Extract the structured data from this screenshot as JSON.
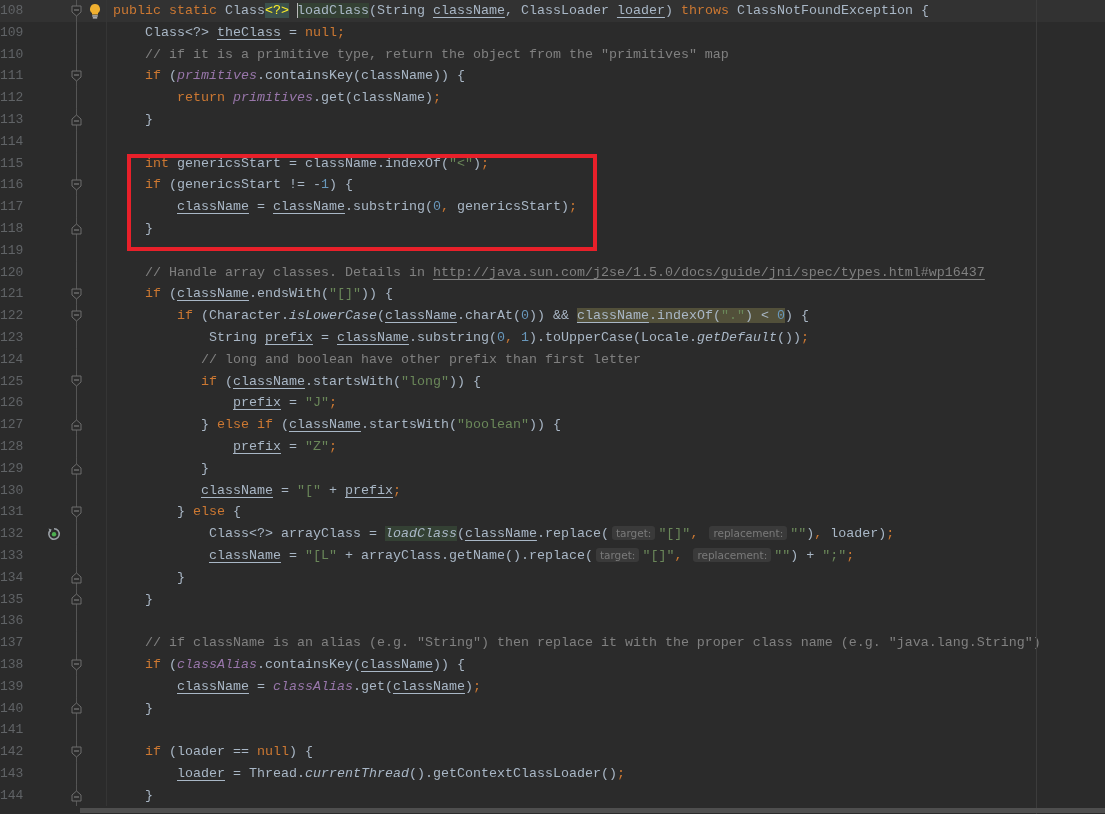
{
  "lines": [
    {
      "number": "108",
      "current": true,
      "fold_start": true,
      "lightbulb": true,
      "tokens": [
        {
          "text": "public static ",
          "kind": "kw"
        },
        {
          "text": "Class",
          "kind": "p"
        },
        {
          "text": "<?>",
          "kind": "p",
          "brace_match": true
        },
        {
          "text": " loadClass",
          "kind": "p",
          "usage": true,
          "caret": true
        },
        {
          "text": "(String ",
          "kind": "p"
        },
        {
          "text": "className",
          "kind": "var"
        },
        {
          "text": ", ClassLoader ",
          "kind": "p"
        },
        {
          "text": "loader",
          "kind": "var"
        },
        {
          "text": ") ",
          "kind": "p"
        },
        {
          "text": "throws ",
          "kind": "kw"
        },
        {
          "text": "ClassNotFoundException {",
          "kind": "p"
        }
      ]
    },
    {
      "number": "109",
      "tokens": [
        {
          "text": "    Class<?> ",
          "kind": "p"
        },
        {
          "text": "theClass",
          "kind": "var"
        },
        {
          "text": " = ",
          "kind": "p"
        },
        {
          "text": "null;",
          "kind": "kw"
        }
      ]
    },
    {
      "number": "110",
      "tokens": [
        {
          "text": "    // if it is a primitive type, return the object from the \"primitives\" map",
          "kind": "comment"
        }
      ]
    },
    {
      "number": "111",
      "fold_start": true,
      "tokens": [
        {
          "text": "    if ",
          "kind": "kw"
        },
        {
          "text": "(",
          "kind": "p"
        },
        {
          "text": "primitives",
          "kind": "field"
        },
        {
          "text": ".containsKey(className)) {",
          "kind": "p"
        }
      ]
    },
    {
      "number": "112",
      "tokens": [
        {
          "text": "        return ",
          "kind": "kw"
        },
        {
          "text": "primitives",
          "kind": "field"
        },
        {
          "text": ".get(className)",
          "kind": "p"
        },
        {
          "text": ";",
          "kind": "kw"
        }
      ]
    },
    {
      "number": "113",
      "fold_end": true,
      "tokens": [
        {
          "text": "    }",
          "kind": "p"
        }
      ]
    },
    {
      "number": "114"
    },
    {
      "number": "115",
      "boxed": true,
      "tokens": [
        {
          "text": "    int ",
          "kind": "kw"
        },
        {
          "text": "genericsStart = className.indexOf(",
          "kind": "p"
        },
        {
          "text": "\"<\"",
          "kind": "str"
        },
        {
          "text": ")",
          "kind": "p"
        },
        {
          "text": ";",
          "kind": "kw"
        }
      ]
    },
    {
      "number": "116",
      "boxed": true,
      "fold_start": true,
      "tokens": [
        {
          "text": "    if ",
          "kind": "kw"
        },
        {
          "text": "(genericsStart != -",
          "kind": "p"
        },
        {
          "text": "1",
          "kind": "num"
        },
        {
          "text": ") {",
          "kind": "p"
        }
      ]
    },
    {
      "number": "117",
      "boxed": true,
      "tokens": [
        {
          "text": "        className",
          "kind": "var"
        },
        {
          "text": " = ",
          "kind": "p"
        },
        {
          "text": "className",
          "kind": "var"
        },
        {
          "text": ".substring(",
          "kind": "p"
        },
        {
          "text": "0",
          "kind": "num"
        },
        {
          "text": ", ",
          "kind": "kw"
        },
        {
          "text": "genericsStart)",
          "kind": "p"
        },
        {
          "text": ";",
          "kind": "kw"
        }
      ]
    },
    {
      "number": "118",
      "boxed": true,
      "fold_end": true,
      "tokens": [
        {
          "text": "    }",
          "kind": "p"
        }
      ]
    },
    {
      "number": "119"
    },
    {
      "number": "120",
      "tokens": [
        {
          "text": "    // Handle array classes. Details in ",
          "kind": "comment"
        },
        {
          "text": "http://java.sun.com/j2se/1.5.0/docs/guide/jni/spec/types.html#wp16437",
          "kind": "link"
        }
      ]
    },
    {
      "number": "121",
      "fold_start": true,
      "tokens": [
        {
          "text": "    if ",
          "kind": "kw"
        },
        {
          "text": "(",
          "kind": "p"
        },
        {
          "text": "className",
          "kind": "var"
        },
        {
          "text": ".endsWith(",
          "kind": "p"
        },
        {
          "text": "\"[]\"",
          "kind": "str"
        },
        {
          "text": ")) {",
          "kind": "p"
        }
      ]
    },
    {
      "number": "122",
      "fold_start": true,
      "tokens": [
        {
          "text": "        if ",
          "kind": "kw"
        },
        {
          "text": "(Character.",
          "kind": "p"
        },
        {
          "text": "isLowerCase",
          "kind": "italic"
        },
        {
          "text": "(",
          "kind": "p"
        },
        {
          "text": "className",
          "kind": "var"
        },
        {
          "text": ".charAt(",
          "kind": "p"
        },
        {
          "text": "0",
          "kind": "num"
        },
        {
          "text": ")) && ",
          "kind": "p"
        },
        {
          "text": "className",
          "kind": "var",
          "warning": true
        },
        {
          "text": ".indexOf(",
          "kind": "p",
          "warning": true
        },
        {
          "text": "\".\"",
          "kind": "str",
          "warning": true
        },
        {
          "text": ") < ",
          "kind": "p",
          "warning": true
        },
        {
          "text": "0",
          "kind": "num",
          "warning": true
        },
        {
          "text": ") {",
          "kind": "p"
        }
      ]
    },
    {
      "number": "123",
      "tokens": [
        {
          "text": "            String ",
          "kind": "p"
        },
        {
          "text": "prefix",
          "kind": "var"
        },
        {
          "text": " = ",
          "kind": "p"
        },
        {
          "text": "className",
          "kind": "var"
        },
        {
          "text": ".substring(",
          "kind": "p"
        },
        {
          "text": "0",
          "kind": "num"
        },
        {
          "text": ", ",
          "kind": "kw"
        },
        {
          "text": "1",
          "kind": "num"
        },
        {
          "text": ").toUpperCase(Locale.",
          "kind": "p"
        },
        {
          "text": "getDefault",
          "kind": "italic"
        },
        {
          "text": "())",
          "kind": "p"
        },
        {
          "text": ";",
          "kind": "kw"
        }
      ]
    },
    {
      "number": "124",
      "tokens": [
        {
          "text": "           // long and boolean have other prefix than first letter",
          "kind": "comment"
        }
      ]
    },
    {
      "number": "125",
      "fold_start": true,
      "tokens": [
        {
          "text": "           if ",
          "kind": "kw"
        },
        {
          "text": "(",
          "kind": "p"
        },
        {
          "text": "className",
          "kind": "var"
        },
        {
          "text": ".startsWith(",
          "kind": "p"
        },
        {
          "text": "\"long\"",
          "kind": "str"
        },
        {
          "text": ")) {",
          "kind": "p"
        }
      ]
    },
    {
      "number": "126",
      "tokens": [
        {
          "text": "               prefix",
          "kind": "var"
        },
        {
          "text": " = ",
          "kind": "p"
        },
        {
          "text": "\"J\"",
          "kind": "str"
        },
        {
          "text": ";",
          "kind": "kw"
        }
      ]
    },
    {
      "number": "127",
      "fold_end": true,
      "tokens": [
        {
          "text": "           } ",
          "kind": "p"
        },
        {
          "text": "else if ",
          "kind": "kw"
        },
        {
          "text": "(",
          "kind": "p"
        },
        {
          "text": "className",
          "kind": "var"
        },
        {
          "text": ".startsWith(",
          "kind": "p"
        },
        {
          "text": "\"boolean\"",
          "kind": "str"
        },
        {
          "text": ")) {",
          "kind": "p"
        }
      ]
    },
    {
      "number": "128",
      "tokens": [
        {
          "text": "               prefix",
          "kind": "var"
        },
        {
          "text": " = ",
          "kind": "p"
        },
        {
          "text": "\"Z\"",
          "kind": "str"
        },
        {
          "text": ";",
          "kind": "kw"
        }
      ]
    },
    {
      "number": "129",
      "fold_end": true,
      "tokens": [
        {
          "text": "           }",
          "kind": "p"
        }
      ]
    },
    {
      "number": "130",
      "tokens": [
        {
          "text": "           className",
          "kind": "var"
        },
        {
          "text": " = ",
          "kind": "p"
        },
        {
          "text": "\"[\"",
          "kind": "str"
        },
        {
          "text": " + ",
          "kind": "p"
        },
        {
          "text": "prefix",
          "kind": "var"
        },
        {
          "text": ";",
          "kind": "kw"
        }
      ]
    },
    {
      "number": "131",
      "fold_start": true,
      "tokens": [
        {
          "text": "        } ",
          "kind": "p"
        },
        {
          "text": "else ",
          "kind": "kw"
        },
        {
          "text": "{",
          "kind": "p"
        }
      ]
    },
    {
      "number": "132",
      "recursion": true,
      "tokens": [
        {
          "text": "            Class<?> arrayClass = ",
          "kind": "p"
        },
        {
          "text": "loadClass",
          "kind": "italic",
          "usage": true
        },
        {
          "text": "(",
          "kind": "p"
        },
        {
          "text": "className",
          "kind": "var"
        },
        {
          "text": ".replace(",
          "kind": "p"
        },
        {
          "text": "target:",
          "kind": "hint"
        },
        {
          "text": "\"[]\"",
          "kind": "str"
        },
        {
          "text": ", ",
          "kind": "kw"
        },
        {
          "text": "replacement:",
          "kind": "hint"
        },
        {
          "text": "\"\"",
          "kind": "str"
        },
        {
          "text": ")",
          "kind": "p"
        },
        {
          "text": ", ",
          "kind": "kw"
        },
        {
          "text": "loader)",
          "kind": "p"
        },
        {
          "text": ";",
          "kind": "kw"
        }
      ]
    },
    {
      "number": "133",
      "tokens": [
        {
          "text": "            className",
          "kind": "var"
        },
        {
          "text": " = ",
          "kind": "p"
        },
        {
          "text": "\"[L\"",
          "kind": "str"
        },
        {
          "text": " + arrayClass.getName().replace(",
          "kind": "p"
        },
        {
          "text": "target:",
          "kind": "hint"
        },
        {
          "text": "\"[]\"",
          "kind": "str"
        },
        {
          "text": ", ",
          "kind": "kw"
        },
        {
          "text": "replacement:",
          "kind": "hint"
        },
        {
          "text": "\"\"",
          "kind": "str"
        },
        {
          "text": ") + ",
          "kind": "p"
        },
        {
          "text": "\";\"",
          "kind": "str"
        },
        {
          "text": ";",
          "kind": "kw"
        }
      ]
    },
    {
      "number": "134",
      "fold_end": true,
      "tokens": [
        {
          "text": "        }",
          "kind": "p"
        }
      ]
    },
    {
      "number": "135",
      "fold_end": true,
      "tokens": [
        {
          "text": "    }",
          "kind": "p"
        }
      ]
    },
    {
      "number": "136"
    },
    {
      "number": "137",
      "tokens": [
        {
          "text": "    // if className is an alias (e.g. \"String\") then replace it with the proper class name (e.g. \"java.lang.String\")",
          "kind": "comment"
        }
      ]
    },
    {
      "number": "138",
      "fold_start": true,
      "tokens": [
        {
          "text": "    if ",
          "kind": "kw"
        },
        {
          "text": "(",
          "kind": "p"
        },
        {
          "text": "classAlias",
          "kind": "field"
        },
        {
          "text": ".containsKey(",
          "kind": "p"
        },
        {
          "text": "className",
          "kind": "var"
        },
        {
          "text": ")) {",
          "kind": "p"
        }
      ]
    },
    {
      "number": "139",
      "tokens": [
        {
          "text": "        className",
          "kind": "var"
        },
        {
          "text": " = ",
          "kind": "p"
        },
        {
          "text": "classAlias",
          "kind": "field"
        },
        {
          "text": ".get(",
          "kind": "p"
        },
        {
          "text": "className",
          "kind": "var"
        },
        {
          "text": ")",
          "kind": "p"
        },
        {
          "text": ";",
          "kind": "kw"
        }
      ]
    },
    {
      "number": "140",
      "fold_end": true,
      "tokens": [
        {
          "text": "    }",
          "kind": "p"
        }
      ]
    },
    {
      "number": "141"
    },
    {
      "number": "142",
      "fold_start": true,
      "tokens": [
        {
          "text": "    if ",
          "kind": "kw"
        },
        {
          "text": "(loader == ",
          "kind": "p"
        },
        {
          "text": "null",
          "kind": "kw"
        },
        {
          "text": ") {",
          "kind": "p"
        }
      ]
    },
    {
      "number": "143",
      "tokens": [
        {
          "text": "        loader",
          "kind": "var"
        },
        {
          "text": " = Thread.",
          "kind": "p"
        },
        {
          "text": "currentThread",
          "kind": "italic"
        },
        {
          "text": "().getContextClassLoader()",
          "kind": "p"
        },
        {
          "text": ";",
          "kind": "kw"
        }
      ]
    },
    {
      "number": "144",
      "fold_end": true,
      "tokens": [
        {
          "text": "    }",
          "kind": "p"
        }
      ]
    }
  ]
}
